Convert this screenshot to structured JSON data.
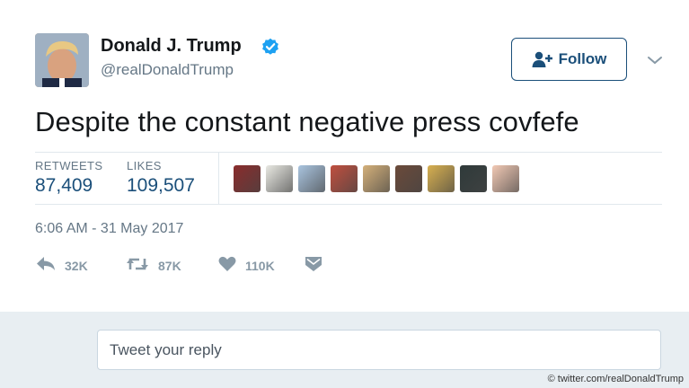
{
  "profile": {
    "display_name": "Donald J. Trump",
    "handle": "@realDonaldTrump",
    "verified": true
  },
  "follow": {
    "label": "Follow",
    "icon": "person-add-icon",
    "color": "#1b4f7a"
  },
  "tweet": {
    "text": "Despite the constant negative press covfefe"
  },
  "stats": {
    "retweets_label": "RETWEETS",
    "retweets_value": "87,409",
    "likes_label": "LIKES",
    "likes_value": "109,507",
    "liker_avatars": [
      {
        "color": "#8a2c2c"
      },
      {
        "color": "#e9e9e3"
      },
      {
        "color": "#a9c4df"
      },
      {
        "color": "#c04f3f"
      },
      {
        "color": "#d4b07a"
      },
      {
        "color": "#6b4a3a"
      },
      {
        "color": "#d8b050"
      },
      {
        "color": "#2f3a3a"
      },
      {
        "color": "#f2c9b4"
      }
    ]
  },
  "timestamp": "6:06 AM - 31 May 2017",
  "actions": {
    "reply": {
      "icon": "reply-icon",
      "count": "32K"
    },
    "retweet": {
      "icon": "retweet-icon",
      "count": "87K"
    },
    "like": {
      "icon": "heart-icon",
      "count": "110K"
    },
    "dm": {
      "icon": "envelope-icon"
    }
  },
  "reply_box": {
    "placeholder": "Tweet your reply"
  },
  "credit": "© twitter.com/realDonaldTrump",
  "colors": {
    "accent": "#1b4f7a",
    "verified": "#1da1f2",
    "muted": "#657786",
    "reply_bg": "#e8eef2"
  }
}
